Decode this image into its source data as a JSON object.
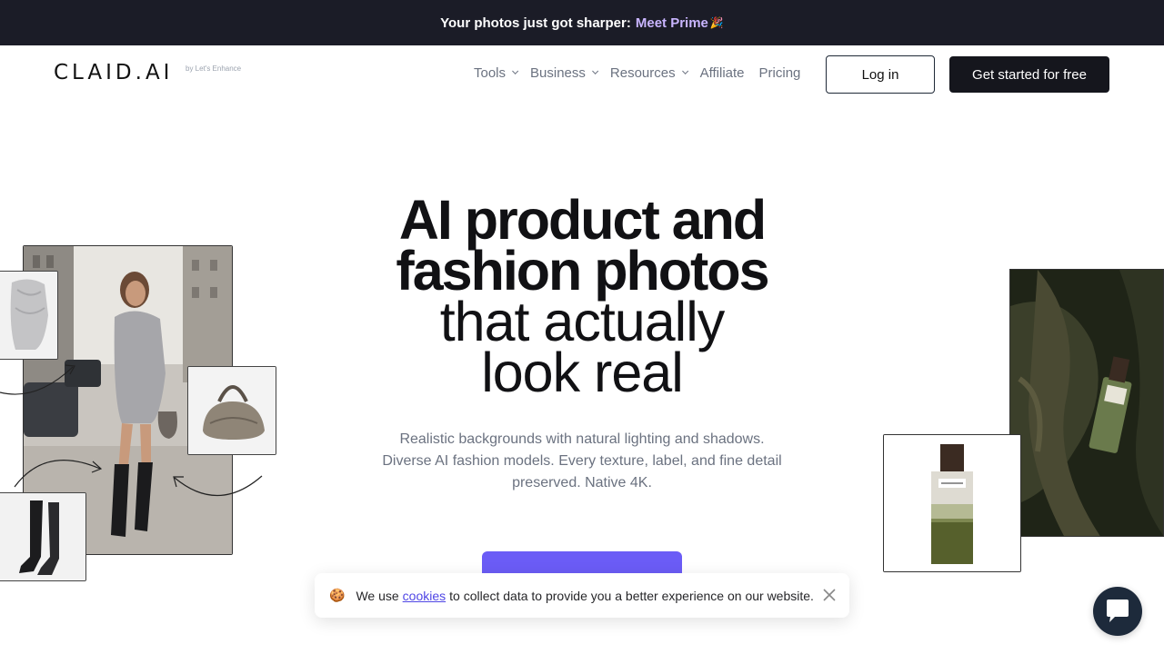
{
  "announcement": {
    "text": "Your photos just got sharper:",
    "link": "Meet Prime",
    "emoji": "🎉"
  },
  "header": {
    "logo": "CLAID.AI",
    "logo_sub": "by Let's Enhance",
    "nav": [
      {
        "label": "Tools",
        "has_dropdown": true
      },
      {
        "label": "Business",
        "has_dropdown": true
      },
      {
        "label": "Resources",
        "has_dropdown": true
      },
      {
        "label": "Affiliate",
        "has_dropdown": false
      },
      {
        "label": "Pricing",
        "has_dropdown": false
      }
    ],
    "login_label": "Log in",
    "start_label": "Get started for free"
  },
  "hero": {
    "title_line1": "AI product and",
    "title_line2": "fashion photos",
    "title_line3": "that actually",
    "title_line4": "look real",
    "subtitle": "Realistic backgrounds with natural lighting and shadows. Diverse AI fashion models. Every texture, label, and fine detail preserved. Native 4K.",
    "cta_label": ""
  },
  "cookie": {
    "icon": "🍪",
    "text_before": "We use",
    "link": "cookies",
    "text_after": "to collect data to provide you a better experience on our website."
  },
  "colors": {
    "announce_bg": "#1b1c27",
    "accent_link": "#c9b5ff",
    "cta": "#6b5cf6",
    "primary_button": "#15161d",
    "chat_bg": "#1d2a3b"
  }
}
